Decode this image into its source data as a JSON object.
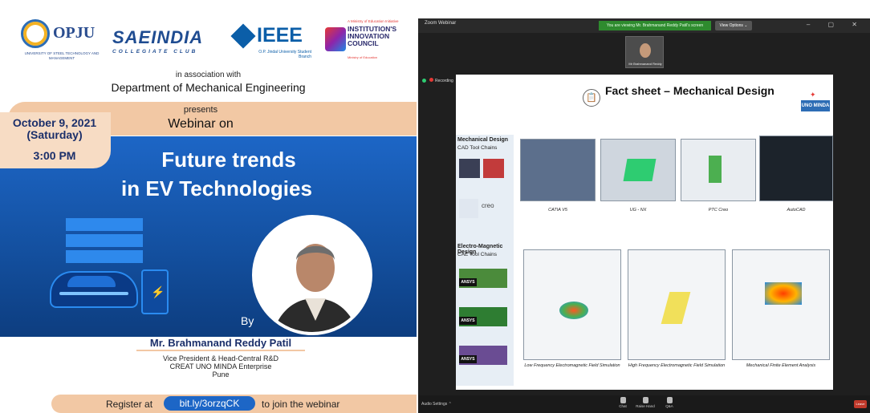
{
  "poster": {
    "logos": {
      "opju": "OPJU",
      "opju_sub": "UNIVERSITY OF STEEL TECHNOLOGY AND MANAGEMENT",
      "sae": "SAEINDIA",
      "sae_sub": "COLLEGIATE CLUB",
      "ieee": "IEEE",
      "ieee_sub": "O.P. Jindal University Student Branch",
      "iic_small": "A Ministry of Education Initiative",
      "iic_title": "INSTITUTION'S INNOVATION COUNCIL",
      "iic_foot": "Ministry of Education"
    },
    "association": "in association with",
    "department": "Department of Mechanical Engineering",
    "presents": "presents",
    "webinar_on": "Webinar on",
    "date": "October 9, 2021 (Saturday)",
    "time": "3:00 PM",
    "title_line1": "Future trends",
    "title_line2": "in EV Technologies",
    "by": "By",
    "speaker_name": "Mr. Brahmanand Reddy Patil",
    "speaker_role1": "Vice President & Head-Central R&D",
    "speaker_role2": "CREAT UNO MINDA Enterprise",
    "speaker_role3": "Pune",
    "register_pre": "Register at",
    "register_link": "bit.ly/3orzqCK",
    "register_post": "to join the webinar",
    "colors": {
      "accent_blue": "#1d66c6",
      "peach": "#f2c8a4",
      "navy": "#1b2f6a"
    }
  },
  "zoom": {
    "window_title": "Zoom Webinar",
    "viewing_banner": "You are viewing Mr. Brahmanand Reddy Patil's screen",
    "view_options": "View Options ⌄",
    "window_controls": "– ▢ ✕",
    "participant_name": "Mr Brahmanand Reddy",
    "recording": "Recording",
    "slide": {
      "title": "Fact sheet – Mechanical Design",
      "brand": "UNO MINDA",
      "section1_title": "Mechanical Design",
      "section1_sub": "CAD Tool Chains",
      "section2_title": "Electro-Magnetic Design",
      "section2_sub": "CAE Tool Chains",
      "brand_creo": "creo",
      "ansys": "ANSYS",
      "captions_top": [
        "CATIA V5",
        "UG - NX",
        "PTC Creo",
        "AutoCAD"
      ],
      "captions_bottom": [
        "Low Frequency Electromagnetic Field Simulation",
        "High Frequency Electromagnetic Field Simulation",
        "Mechanical Finite Element Analysis"
      ]
    },
    "bottom": {
      "audio_settings": "Audio Settings ⌃",
      "chat": "Chat",
      "raise_hand": "Raise Hand",
      "qa": "Q&A",
      "leave": "Leave"
    }
  }
}
